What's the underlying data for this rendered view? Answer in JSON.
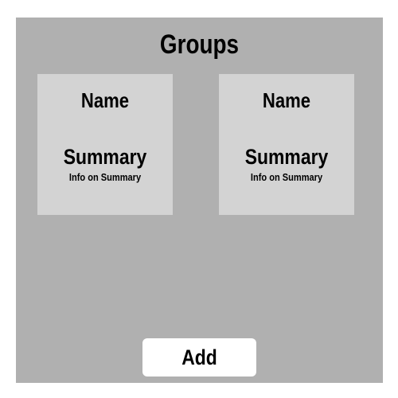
{
  "page": {
    "title": "Groups"
  },
  "groups": [
    {
      "name": "Name",
      "summary": "Summary",
      "info": "Info on Summary"
    },
    {
      "name": "Name",
      "summary": "Summary",
      "info": "Info on Summary"
    }
  ],
  "actions": {
    "add_label": "Add"
  },
  "colors": {
    "panel_background": "#b0b0b0",
    "card_background": "#d3d3d3",
    "button_background": "#ffffff",
    "text": "#000000"
  }
}
